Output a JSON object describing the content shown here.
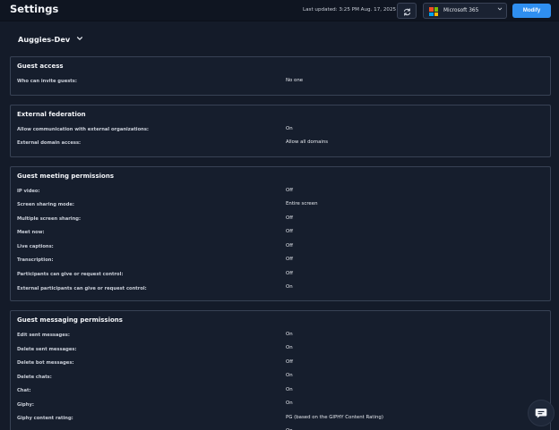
{
  "header": {
    "title": "Settings",
    "last_updated": "Last updated: 3:25 PM Aug. 17, 2025",
    "provider": {
      "label": "Microsoft 365",
      "logo_colors": [
        "#f25022",
        "#7fba00",
        "#00a4ef",
        "#ffb900"
      ]
    },
    "modify_label": "Modify"
  },
  "org": {
    "name": "Auggies-Dev"
  },
  "guest_access": {
    "title": "Guest access",
    "rows": [
      {
        "label": "Who can invite guests:",
        "value": "No one"
      }
    ]
  },
  "external_federation": {
    "title": "External federation",
    "rows": [
      {
        "label": "Allow communication with external organizations:",
        "value": "On"
      },
      {
        "label": "External domain access:",
        "value": "Allow all domains"
      }
    ]
  },
  "guest_meeting": {
    "title": "Guest meeting permissions",
    "rows": [
      {
        "label": "IP video:",
        "value": "Off"
      },
      {
        "label": "Screen sharing mode:",
        "value": "Entire screen"
      },
      {
        "label": "Multiple screen sharing:",
        "value": "Off"
      },
      {
        "label": "Meet now:",
        "value": "Off"
      },
      {
        "label": "Live captions:",
        "value": "Off"
      },
      {
        "label": "Transcription:",
        "value": "Off"
      },
      {
        "label": "Participants can give or request control:",
        "value": "Off"
      },
      {
        "label": "External participants can give or request control:",
        "value": "On"
      }
    ]
  },
  "guest_messaging": {
    "title": "Guest messaging permissions",
    "rows": [
      {
        "label": "Edit sent messages:",
        "value": "On"
      },
      {
        "label": "Delete sent messages:",
        "value": "On"
      },
      {
        "label": "Delete bot messages:",
        "value": "Off"
      },
      {
        "label": "Delete chats:",
        "value": "On"
      },
      {
        "label": "Chat:",
        "value": "On"
      },
      {
        "label": "Giphy:",
        "value": "On"
      },
      {
        "label": "Giphy content rating:",
        "value": "PG (based on the GIPHY Content Rating)"
      },
      {
        "label": "",
        "value": "On"
      }
    ]
  },
  "icons": {
    "refresh": "refresh-icon",
    "dropdown": "chevron-down-icon",
    "chat": "chat-bubble-icon"
  }
}
